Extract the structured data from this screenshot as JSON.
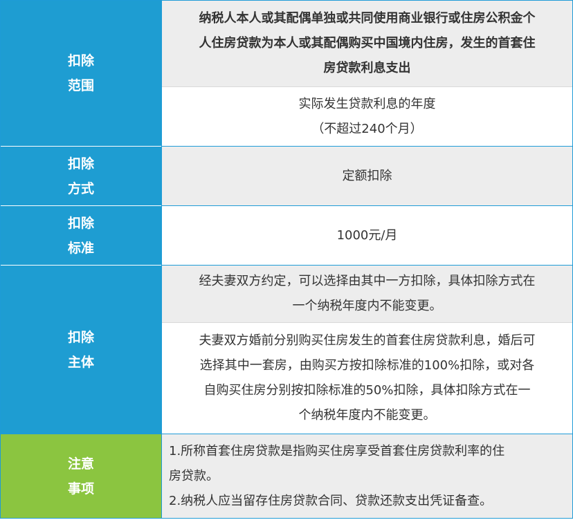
{
  "rows": {
    "scope": {
      "label_line1": "扣除",
      "label_line2": "范围",
      "text_lines": [
        "纳税人本人或其配偶单独或共同使用商业银行或住房公积金个",
        "人住房贷款为本人或其配偶购买中国境内住房，发生的首套住",
        "房贷款利息支出"
      ],
      "period_line1": "实际发生贷款利息的年度",
      "period_line2": "（不超过240个月）"
    },
    "method": {
      "label_line1": "扣除",
      "label_line2": "方式",
      "text": "定额扣除"
    },
    "standard": {
      "label_line1": "扣除",
      "label_line2": "标准",
      "text": "1000元/月"
    },
    "subject": {
      "label_line1": "扣除",
      "label_line2": "主体",
      "para1_lines": [
        "经夫妻双方约定，可以选择由其中一方扣除，具体扣除方式在",
        "一个纳税年度内不能变更。"
      ],
      "para2_lines": [
        "夫妻双方婚前分别购买住房发生的首套住房贷款利息，婚后可",
        "选择其中一套房，由购买方按扣除标准的100%扣除，或对各",
        "自购买住房分别按扣除标准的50%扣除，具体扣除方式在一",
        "个纳税年度内不能变更。"
      ]
    },
    "notes": {
      "label_line1": "注意",
      "label_line2": "事项",
      "note1_lines": [
        "1.所称首套住房贷款是指购买住房享受首套住房贷款利率的住",
        "房贷款。"
      ],
      "note2": "2.纳税人应当留存住房贷款合同、贷款还款支出凭证备查。"
    }
  }
}
